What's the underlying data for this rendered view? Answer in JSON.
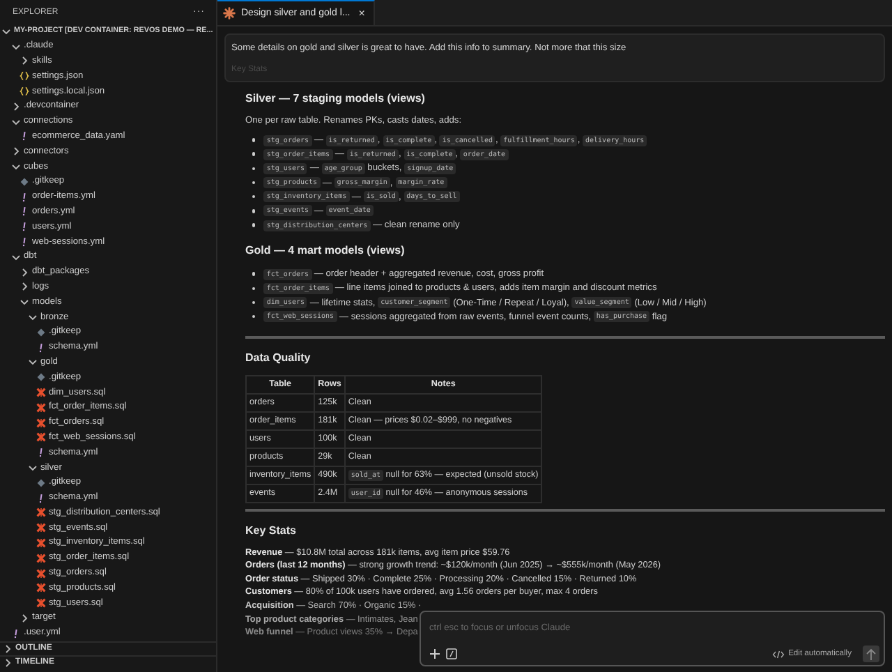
{
  "sidebar": {
    "title": "EXPLORER",
    "more": "···",
    "root": {
      "name": "MY-PROJECT [DEV CONTAINER: REVOS DEMO — RE...",
      "expanded": true
    },
    "tree": [
      {
        "name": ".claude",
        "kind": "folder",
        "expanded": true,
        "children": [
          {
            "name": "skills",
            "kind": "folder",
            "expanded": false
          },
          {
            "name": "settings.json",
            "kind": "json"
          },
          {
            "name": "settings.local.json",
            "kind": "json"
          }
        ]
      },
      {
        "name": ".devcontainer",
        "kind": "folder",
        "expanded": false
      },
      {
        "name": "connections",
        "kind": "folder",
        "expanded": true,
        "children": [
          {
            "name": "ecommerce_data.yaml",
            "kind": "yaml"
          }
        ]
      },
      {
        "name": "connectors",
        "kind": "folder",
        "expanded": false
      },
      {
        "name": "cubes",
        "kind": "folder",
        "expanded": true,
        "children": [
          {
            "name": ".gitkeep",
            "kind": "gitkeep"
          },
          {
            "name": "order-items.yml",
            "kind": "yaml"
          },
          {
            "name": "orders.yml",
            "kind": "yaml"
          },
          {
            "name": "users.yml",
            "kind": "yaml"
          },
          {
            "name": "web-sessions.yml",
            "kind": "yaml"
          }
        ]
      },
      {
        "name": "dbt",
        "kind": "folder",
        "expanded": true,
        "children": [
          {
            "name": "dbt_packages",
            "kind": "folder",
            "expanded": false
          },
          {
            "name": "logs",
            "kind": "folder",
            "expanded": false
          },
          {
            "name": "models",
            "kind": "folder",
            "expanded": true,
            "children": [
              {
                "name": "bronze",
                "kind": "folder",
                "expanded": true,
                "children": [
                  {
                    "name": ".gitkeep",
                    "kind": "gitkeep"
                  },
                  {
                    "name": "schema.yml",
                    "kind": "yaml"
                  }
                ]
              },
              {
                "name": "gold",
                "kind": "folder",
                "expanded": true,
                "children": [
                  {
                    "name": ".gitkeep",
                    "kind": "gitkeep"
                  },
                  {
                    "name": "dim_users.sql",
                    "kind": "sql"
                  },
                  {
                    "name": "fct_order_items.sql",
                    "kind": "sql"
                  },
                  {
                    "name": "fct_orders.sql",
                    "kind": "sql"
                  },
                  {
                    "name": "fct_web_sessions.sql",
                    "kind": "sql"
                  },
                  {
                    "name": "schema.yml",
                    "kind": "yaml"
                  }
                ]
              },
              {
                "name": "silver",
                "kind": "folder",
                "expanded": true,
                "children": [
                  {
                    "name": ".gitkeep",
                    "kind": "gitkeep"
                  },
                  {
                    "name": "schema.yml",
                    "kind": "yaml"
                  },
                  {
                    "name": "stg_distribution_centers.sql",
                    "kind": "sql"
                  },
                  {
                    "name": "stg_events.sql",
                    "kind": "sql"
                  },
                  {
                    "name": "stg_inventory_items.sql",
                    "kind": "sql"
                  },
                  {
                    "name": "stg_order_items.sql",
                    "kind": "sql"
                  },
                  {
                    "name": "stg_orders.sql",
                    "kind": "sql"
                  },
                  {
                    "name": "stg_products.sql",
                    "kind": "sql"
                  },
                  {
                    "name": "stg_users.sql",
                    "kind": "sql"
                  }
                ]
              }
            ]
          },
          {
            "name": "target",
            "kind": "folder",
            "expanded": false
          }
        ]
      },
      {
        "name": ".user.yml",
        "kind": "yaml"
      }
    ],
    "panels": [
      {
        "title": "OUTLINE",
        "expanded": false
      },
      {
        "title": "TIMELINE",
        "expanded": false
      }
    ]
  },
  "tabs": [
    {
      "label": "Design silver and gold l...",
      "selected": true,
      "close": "×"
    }
  ],
  "message": {
    "text": "Some details on gold and silver is great to have. Add this info to summary. Not more that this size",
    "faded": "Key Stats"
  },
  "silver": {
    "heading": "Silver — 7 staging models (views)",
    "intro": "One per raw table. Renames PKs, casts dates, adds:",
    "items": [
      [
        {
          "kind": "code",
          "text": "stg_orders"
        },
        {
          "kind": "text",
          "text": " — "
        },
        {
          "kind": "code",
          "text": "is_returned"
        },
        {
          "kind": "text",
          "text": ", "
        },
        {
          "kind": "code",
          "text": "is_complete"
        },
        {
          "kind": "text",
          "text": ", "
        },
        {
          "kind": "code",
          "text": "is_cancelled"
        },
        {
          "kind": "text",
          "text": ", "
        },
        {
          "kind": "code",
          "text": "fulfillment_hours"
        },
        {
          "kind": "text",
          "text": ", "
        },
        {
          "kind": "code",
          "text": "delivery_hours"
        }
      ],
      [
        {
          "kind": "code",
          "text": "stg_order_items"
        },
        {
          "kind": "text",
          "text": " — "
        },
        {
          "kind": "code",
          "text": "is_returned"
        },
        {
          "kind": "text",
          "text": ", "
        },
        {
          "kind": "code",
          "text": "is_complete"
        },
        {
          "kind": "text",
          "text": ", "
        },
        {
          "kind": "code",
          "text": "order_date"
        }
      ],
      [
        {
          "kind": "code",
          "text": "stg_users"
        },
        {
          "kind": "text",
          "text": " — "
        },
        {
          "kind": "code",
          "text": "age_group"
        },
        {
          "kind": "text",
          "text": " buckets, "
        },
        {
          "kind": "code",
          "text": "signup_date"
        }
      ],
      [
        {
          "kind": "code",
          "text": "stg_products"
        },
        {
          "kind": "text",
          "text": " — "
        },
        {
          "kind": "code",
          "text": "gross_margin"
        },
        {
          "kind": "text",
          "text": ", "
        },
        {
          "kind": "code",
          "text": "margin_rate"
        }
      ],
      [
        {
          "kind": "code",
          "text": "stg_inventory_items"
        },
        {
          "kind": "text",
          "text": " — "
        },
        {
          "kind": "code",
          "text": "is_sold"
        },
        {
          "kind": "text",
          "text": ", "
        },
        {
          "kind": "code",
          "text": "days_to_sell"
        }
      ],
      [
        {
          "kind": "code",
          "text": "stg_events"
        },
        {
          "kind": "text",
          "text": " — "
        },
        {
          "kind": "code",
          "text": "event_date"
        }
      ],
      [
        {
          "kind": "code",
          "text": "stg_distribution_centers"
        },
        {
          "kind": "text",
          "text": " — clean rename only"
        }
      ]
    ]
  },
  "gold": {
    "heading": "Gold — 4 mart models (views)",
    "items": [
      [
        {
          "kind": "code",
          "text": "fct_orders"
        },
        {
          "kind": "text",
          "text": " — order header + aggregated revenue, cost, gross profit"
        }
      ],
      [
        {
          "kind": "code",
          "text": "fct_order_items"
        },
        {
          "kind": "text",
          "text": " — line items joined to products & users, adds item margin and discount metrics"
        }
      ],
      [
        {
          "kind": "code",
          "text": "dim_users"
        },
        {
          "kind": "text",
          "text": " — lifetime stats, "
        },
        {
          "kind": "code",
          "text": "customer_segment"
        },
        {
          "kind": "text",
          "text": " (One-Time / Repeat / Loyal), "
        },
        {
          "kind": "code",
          "text": "value_segment"
        },
        {
          "kind": "text",
          "text": " (Low / Mid / High)"
        }
      ],
      [
        {
          "kind": "code",
          "text": "fct_web_sessions"
        },
        {
          "kind": "text",
          "text": " — sessions aggregated from raw events, funnel event counts, "
        },
        {
          "kind": "code",
          "text": "has_purchase"
        },
        {
          "kind": "text",
          "text": " flag"
        }
      ]
    ]
  },
  "data_quality": {
    "heading": "Data Quality",
    "columns": [
      "Table",
      "Rows",
      "Notes"
    ],
    "rows": [
      [
        [
          {
            "kind": "text",
            "text": "orders"
          }
        ],
        [
          {
            "kind": "text",
            "text": "125k"
          }
        ],
        [
          {
            "kind": "text",
            "text": "Clean"
          }
        ]
      ],
      [
        [
          {
            "kind": "text",
            "text": "order_items"
          }
        ],
        [
          {
            "kind": "text",
            "text": "181k"
          }
        ],
        [
          {
            "kind": "text",
            "text": "Clean — prices $0.02–$999, no negatives"
          }
        ]
      ],
      [
        [
          {
            "kind": "text",
            "text": "users"
          }
        ],
        [
          {
            "kind": "text",
            "text": "100k"
          }
        ],
        [
          {
            "kind": "text",
            "text": "Clean"
          }
        ]
      ],
      [
        [
          {
            "kind": "text",
            "text": "products"
          }
        ],
        [
          {
            "kind": "text",
            "text": "29k"
          }
        ],
        [
          {
            "kind": "text",
            "text": "Clean"
          }
        ]
      ],
      [
        [
          {
            "kind": "text",
            "text": "inventory_items"
          }
        ],
        [
          {
            "kind": "text",
            "text": "490k"
          }
        ],
        [
          {
            "kind": "code",
            "text": "sold_at"
          },
          {
            "kind": "text",
            "text": " null for 63% — expected (unsold stock)"
          }
        ]
      ],
      [
        [
          {
            "kind": "text",
            "text": "events"
          }
        ],
        [
          {
            "kind": "text",
            "text": "2.4M"
          }
        ],
        [
          {
            "kind": "code",
            "text": "user_id"
          },
          {
            "kind": "text",
            "text": " null for 46% — anonymous sessions"
          }
        ]
      ]
    ]
  },
  "key_stats": {
    "heading": "Key Stats",
    "lines": [
      "**Revenue** — $10.8M total across 181k items, avg item price $59.76",
      "**Orders (last 12 months)** — strong growth trend: ~$120k/month (Jun 2025) → ~$555k/month (May 2026)",
      "**Order status** — Shipped 30% · Complete 25% · Processing 20% · Cancelled 15% · Returned 10%",
      "**Customers** — 80% of 100k users have ordered, avg 1.56 orders per buyer, max 4 orders",
      "**Acquisition** — Search 70% · Organic 15% ·",
      "**Top product categories** — Intimates, Jean",
      "**Web funnel** — Product views 35% → Depa"
    ]
  },
  "chat_input": {
    "placeholder": "ctrl esc to focus or unfocus Claude",
    "mode": "Edit automatically"
  }
}
